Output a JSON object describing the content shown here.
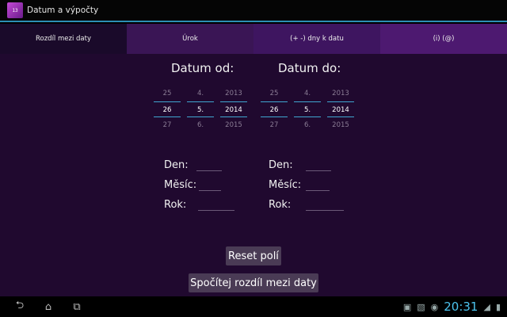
{
  "app": {
    "title": "Datum a výpočty",
    "icon_text": "13"
  },
  "tabs": [
    {
      "label": "Rozdíl mezi daty"
    },
    {
      "label": "Úrok"
    },
    {
      "label": "(+ -) dny k datu"
    },
    {
      "label": "(i) (@)"
    }
  ],
  "from_picker": {
    "title": "Datum od:",
    "day": {
      "prev": "25",
      "sel": "26",
      "next": "27"
    },
    "month": {
      "prev": "4.",
      "sel": "5.",
      "next": "6."
    },
    "year": {
      "prev": "2013",
      "sel": "2014",
      "next": "2015"
    }
  },
  "to_picker": {
    "title": "Datum do:",
    "day": {
      "prev": "25",
      "sel": "26",
      "next": "27"
    },
    "month": {
      "prev": "4.",
      "sel": "5.",
      "next": "6."
    },
    "year": {
      "prev": "2013",
      "sel": "2014",
      "next": "2015"
    }
  },
  "result_labels": {
    "day": "Den:",
    "month": "Měsíc:",
    "year": "Rok:"
  },
  "buttons": {
    "reset": "Reset polí",
    "calculate": "Spočítej rozdíl mezi daty"
  },
  "status": {
    "clock": "20:31"
  },
  "icons": {
    "back": "back-icon",
    "home": "home-icon",
    "recents": "recents-icon",
    "gallery": "gallery-icon",
    "camera": "camera-icon",
    "wifi": "wifi-icon",
    "battery": "battery-icon"
  },
  "colors": {
    "accent": "#2b8fb5",
    "clock": "#4cc3ee",
    "background": "#20092f",
    "button": "#4a3b55"
  }
}
